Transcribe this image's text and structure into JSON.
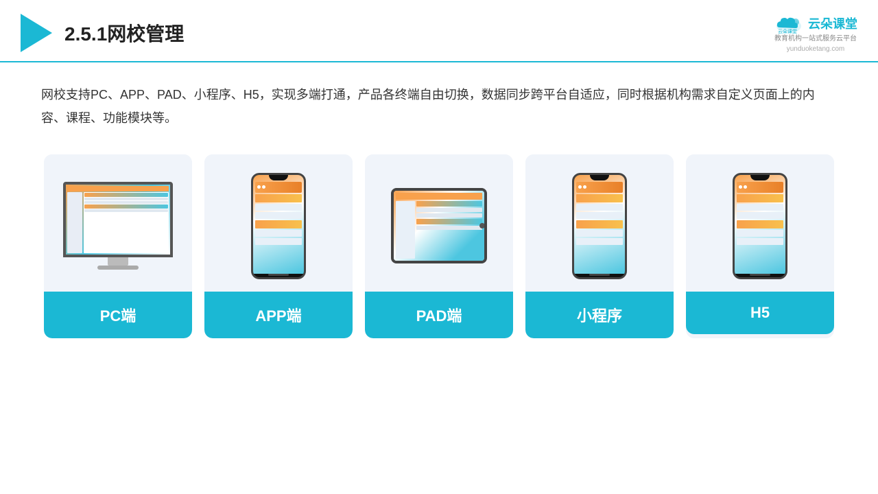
{
  "header": {
    "title": "2.5.1网校管理",
    "brand_name": "云朵课堂",
    "brand_url": "yunduoketang.com",
    "brand_slogan": "教育机构一站\n式服务云平台"
  },
  "description": "网校支持PC、APP、PAD、小程序、H5，实现多端打通，产品各终端自由切换，数据同步跨平台自适应，同时根据机构需求自定义页面上的内容、课程、功能模块等。",
  "cards": [
    {
      "id": "pc",
      "label": "PC端"
    },
    {
      "id": "app",
      "label": "APP端"
    },
    {
      "id": "pad",
      "label": "PAD端"
    },
    {
      "id": "miniapp",
      "label": "小程序"
    },
    {
      "id": "h5",
      "label": "H5"
    }
  ],
  "accent_color": "#1bb8d4"
}
